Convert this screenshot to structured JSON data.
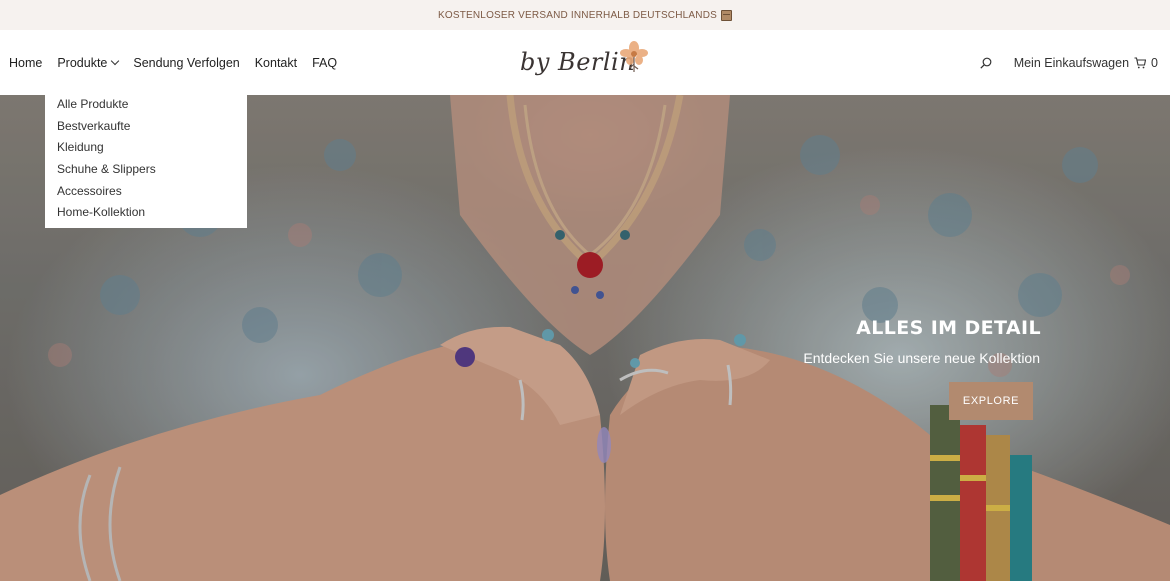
{
  "announcement": {
    "text": "KOSTENLOSER VERSAND INNERHALB DEUTSCHLANDS",
    "icon": "package-icon"
  },
  "nav": {
    "items": [
      {
        "label": "Home"
      },
      {
        "label": "Produkte",
        "has_dropdown": true
      },
      {
        "label": "Sendung Verfolgen"
      },
      {
        "label": "Kontakt"
      },
      {
        "label": "FAQ"
      }
    ]
  },
  "logo": {
    "text": "by Berlin"
  },
  "header_tools": {
    "search_icon": "search-icon",
    "cart_label": "Mein Einkaufswagen",
    "cart_icon": "cart-icon",
    "cart_count": "0"
  },
  "dropdown": {
    "items": [
      {
        "label": "Alle Produkte"
      },
      {
        "label": "Bestverkaufte"
      },
      {
        "label": "Kleidung"
      },
      {
        "label": "Schuhe & Slippers"
      },
      {
        "label": "Accessoires"
      },
      {
        "label": "Home-Kollektion"
      }
    ]
  },
  "hero": {
    "title": "ALLES IM DETAIL",
    "subtitle": "Entdecken Sie unsere neue Kollektion",
    "button_label": "EXPLORE",
    "button_color": "#b28a6f"
  },
  "colors": {
    "announcement_bg": "#f6f2ef",
    "announcement_text": "#7d5a45",
    "accent": "#b28a6f"
  }
}
